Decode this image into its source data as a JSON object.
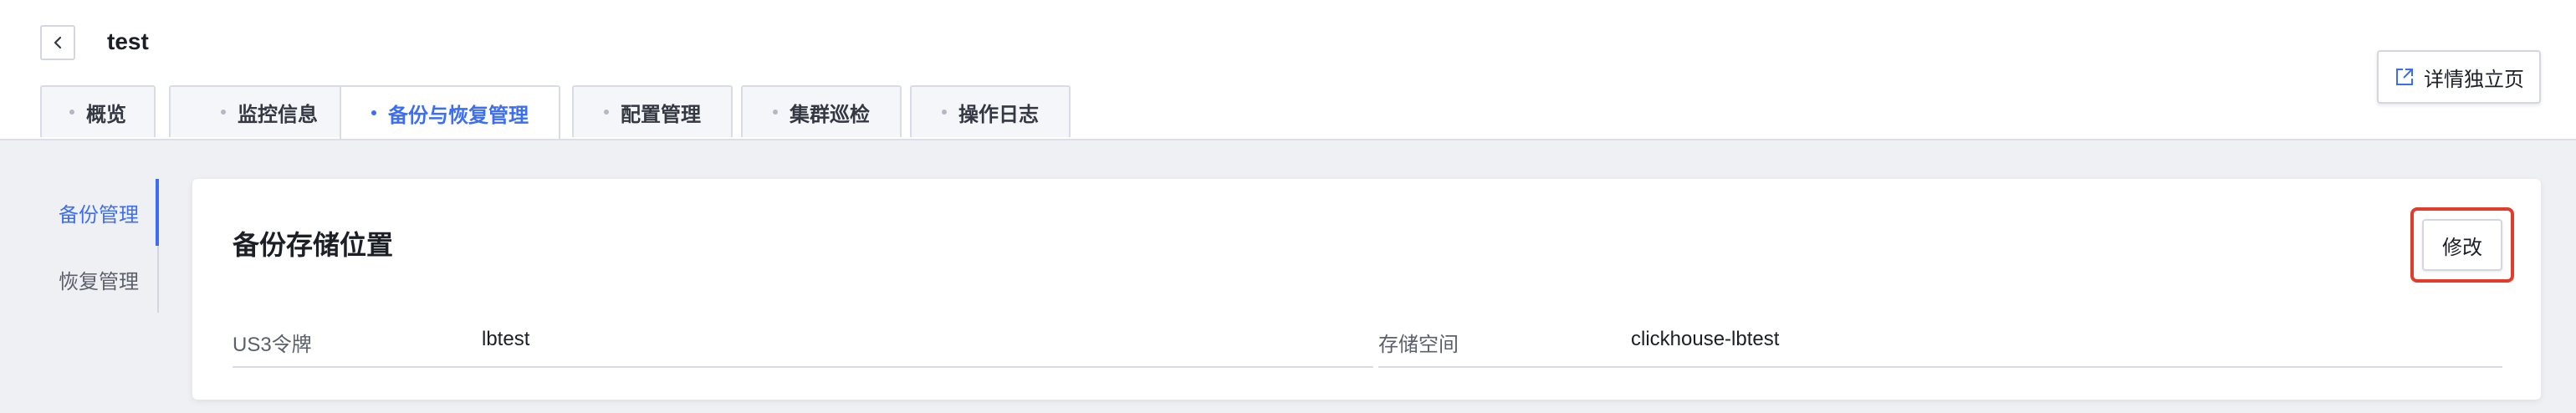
{
  "header": {
    "title": "test",
    "back_icon": "chevron-left-icon",
    "standalone_label": "详情独立页",
    "standalone_icon": "external-link-icon"
  },
  "tabs": [
    {
      "label": "概览",
      "active": false
    },
    {
      "label": "监控信息",
      "active": false
    },
    {
      "label": "备份与恢复管理",
      "active": true
    },
    {
      "label": "配置管理",
      "active": false
    },
    {
      "label": "集群巡检",
      "active": false
    },
    {
      "label": "操作日志",
      "active": false
    }
  ],
  "sidebar": {
    "items": [
      {
        "label": "备份管理",
        "active": true
      },
      {
        "label": "恢复管理",
        "active": false
      }
    ]
  },
  "card": {
    "title": "备份存储位置",
    "edit_label": "修改",
    "fields": [
      {
        "label": "US3令牌",
        "value": "lbtest"
      },
      {
        "label": "存储空间",
        "value": "clickhouse-lbtest"
      }
    ]
  },
  "colors": {
    "accent": "#3b6ef5",
    "highlight_border": "#e23c2a",
    "page_bg": "#eff0f4"
  }
}
